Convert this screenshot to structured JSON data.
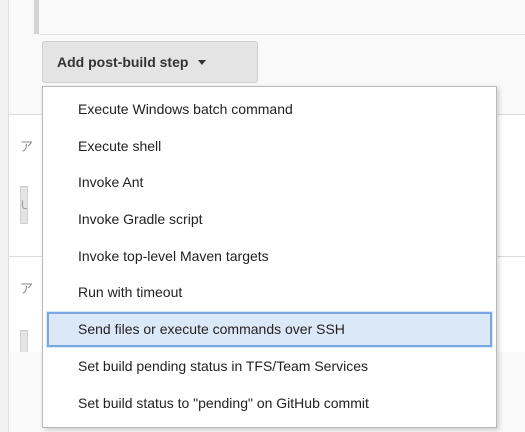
{
  "add_step": {
    "label": "Add post-build step"
  },
  "menu": {
    "items": [
      {
        "label": "Execute Windows batch command"
      },
      {
        "label": "Execute shell"
      },
      {
        "label": "Invoke Ant"
      },
      {
        "label": "Invoke Gradle script"
      },
      {
        "label": "Invoke top-level Maven targets"
      },
      {
        "label": "Run with timeout"
      },
      {
        "label": "Send files or execute commands over SSH",
        "highlighted": true
      },
      {
        "label": "Set build pending status in TFS/Team Services"
      },
      {
        "label": "Set build status to \"pending\" on GitHub commit"
      }
    ]
  },
  "background": {
    "glyph_1": "ア",
    "glyph_2": "ア",
    "field_1": "U"
  },
  "colors": {
    "highlight_fill": "#dbe8f8",
    "highlight_border": "#7aa7e0",
    "button_bg": "#e4e4e4"
  }
}
